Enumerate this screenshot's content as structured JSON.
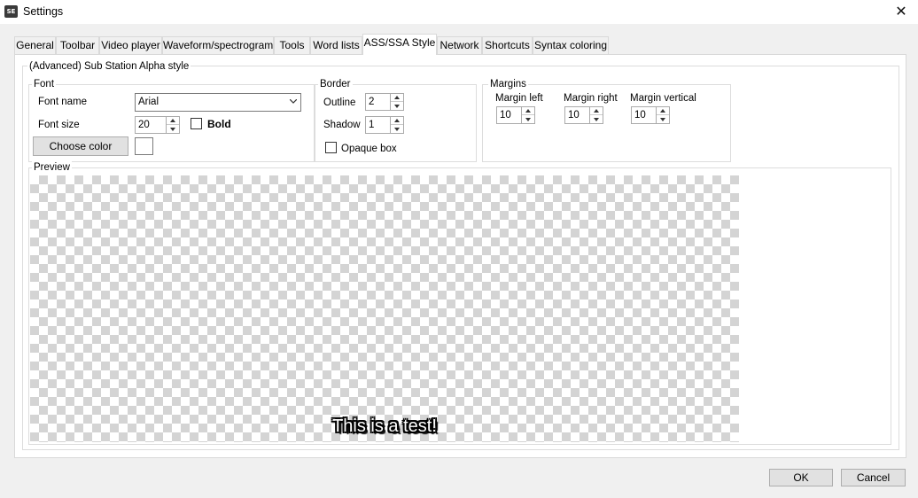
{
  "window": {
    "title": "Settings",
    "icon": "SE"
  },
  "tabs": [
    {
      "label": "General"
    },
    {
      "label": "Toolbar"
    },
    {
      "label": "Video player"
    },
    {
      "label": "Waveform/spectrogram"
    },
    {
      "label": "Tools"
    },
    {
      "label": "Word lists"
    },
    {
      "label": "ASS/SSA Style"
    },
    {
      "label": "Network"
    },
    {
      "label": "Shortcuts"
    },
    {
      "label": "Syntax coloring"
    }
  ],
  "active_tab": "ASS/SSA Style",
  "section_title": "(Advanced) Sub Station Alpha style",
  "font": {
    "group_label": "Font",
    "name_label": "Font name",
    "name_value": "Arial",
    "size_label": "Font size",
    "size_value": "20",
    "bold_label": "Bold",
    "bold_checked": false,
    "choose_color_label": "Choose color",
    "color": "#ffffff"
  },
  "border": {
    "group_label": "Border",
    "outline_label": "Outline",
    "outline_value": "2",
    "shadow_label": "Shadow",
    "shadow_value": "1",
    "opaque_label": "Opaque box",
    "opaque_checked": false
  },
  "margins": {
    "group_label": "Margins",
    "left_label": "Margin left",
    "left_value": "10",
    "right_label": "Margin right",
    "right_value": "10",
    "vertical_label": "Margin vertical",
    "vertical_value": "10"
  },
  "preview": {
    "label": "Preview",
    "text": "This is a test!"
  },
  "footer": {
    "ok_label": "OK",
    "cancel_label": "Cancel"
  }
}
